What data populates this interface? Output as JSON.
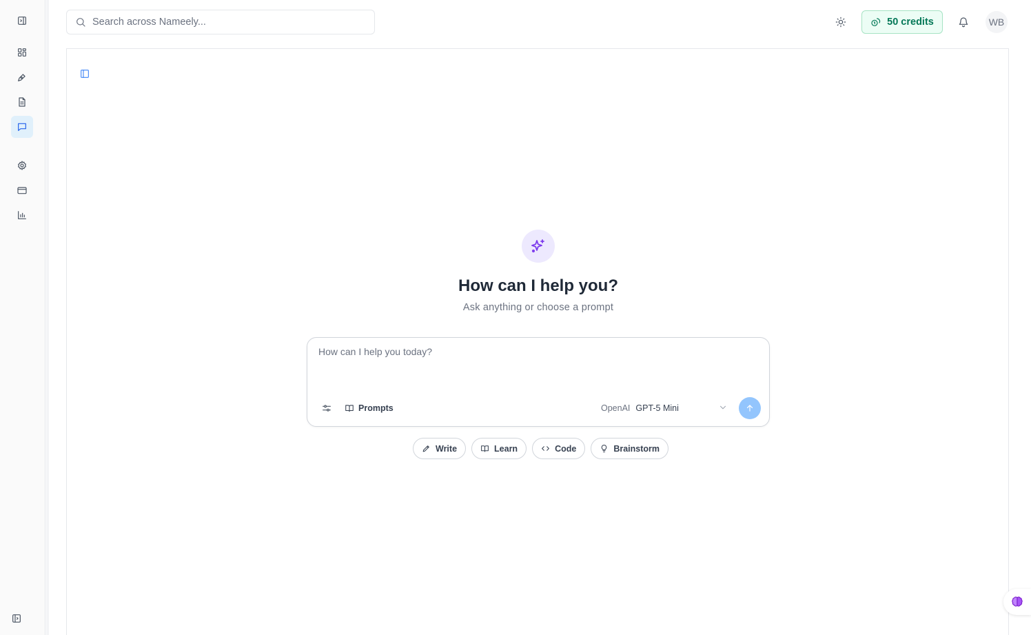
{
  "rail": {
    "items": [
      {
        "name": "collapse-sidebar",
        "icon": "panel-left-icon"
      },
      {
        "name": "dashboard",
        "icon": "grid-icon"
      },
      {
        "name": "brand",
        "icon": "pen-tool-icon"
      },
      {
        "name": "documents",
        "icon": "file-text-icon"
      },
      {
        "name": "chat",
        "icon": "message-square-icon",
        "active": true
      },
      {
        "name": "settings",
        "icon": "gear-icon"
      },
      {
        "name": "billing",
        "icon": "credit-card-icon"
      },
      {
        "name": "analytics",
        "icon": "bar-chart-icon"
      },
      {
        "name": "expand-sidebar",
        "icon": "panel-right-icon"
      }
    ]
  },
  "header": {
    "search_placeholder": "Search across Nameely...",
    "credits_label": "50 credits",
    "avatar_initials": "WB"
  },
  "hero": {
    "title": "How can I help you?",
    "subtitle": "Ask anything or choose a prompt"
  },
  "composer": {
    "placeholder": "How can I help you today?",
    "prompts_label": "Prompts",
    "model_provider": "OpenAI",
    "model_name": "GPT-5 Mini"
  },
  "chips": [
    {
      "label": "Write",
      "icon": "pencil-icon"
    },
    {
      "label": "Learn",
      "icon": "book-open-icon"
    },
    {
      "label": "Code",
      "icon": "code-icon"
    },
    {
      "label": "Brainstorm",
      "icon": "lightbulb-icon"
    }
  ],
  "colors": {
    "accent": "#3b82f6",
    "credits_green": "#047857",
    "hero_purple": "#7c3aed",
    "send_blue": "#93c5fd"
  }
}
